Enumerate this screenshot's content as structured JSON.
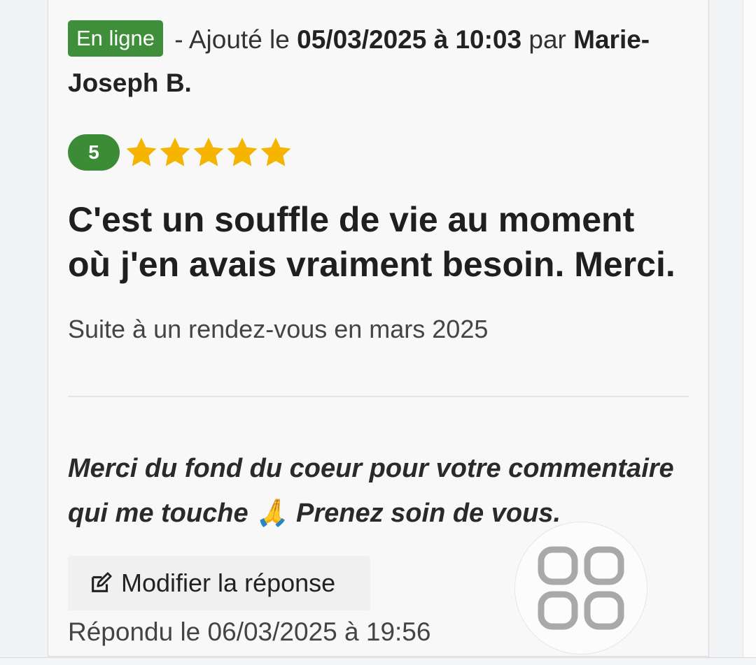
{
  "review": {
    "status_badge": "En ligne",
    "added_prefix": " - Ajouté le ",
    "date_time": "05/03/2025 à 10:03",
    "by_label": " par ",
    "author": "Marie-Joseph B.",
    "rating": "5",
    "stars_filled": 5,
    "stars_total": 5,
    "title": "C'est un souffle de vie au moment où j'en avais vraiment besoin. Merci.",
    "context": "Suite à un rendez-vous en mars 2025"
  },
  "response": {
    "text": "Merci du fond du coeur pour votre commentaire qui me touche 🙏 Prenez soin de vous.",
    "edit_button_label": "Modifier la réponse",
    "replied_text": "Répondu le 06/03/2025 à 19:56"
  },
  "icons": {
    "edit": "edit-icon",
    "star": "star-icon",
    "apps": "apps-grid-icon"
  },
  "colors": {
    "badge_green": "#3f8f3a",
    "rating_green": "#3c8b37",
    "star_yellow": "#f4b400"
  }
}
